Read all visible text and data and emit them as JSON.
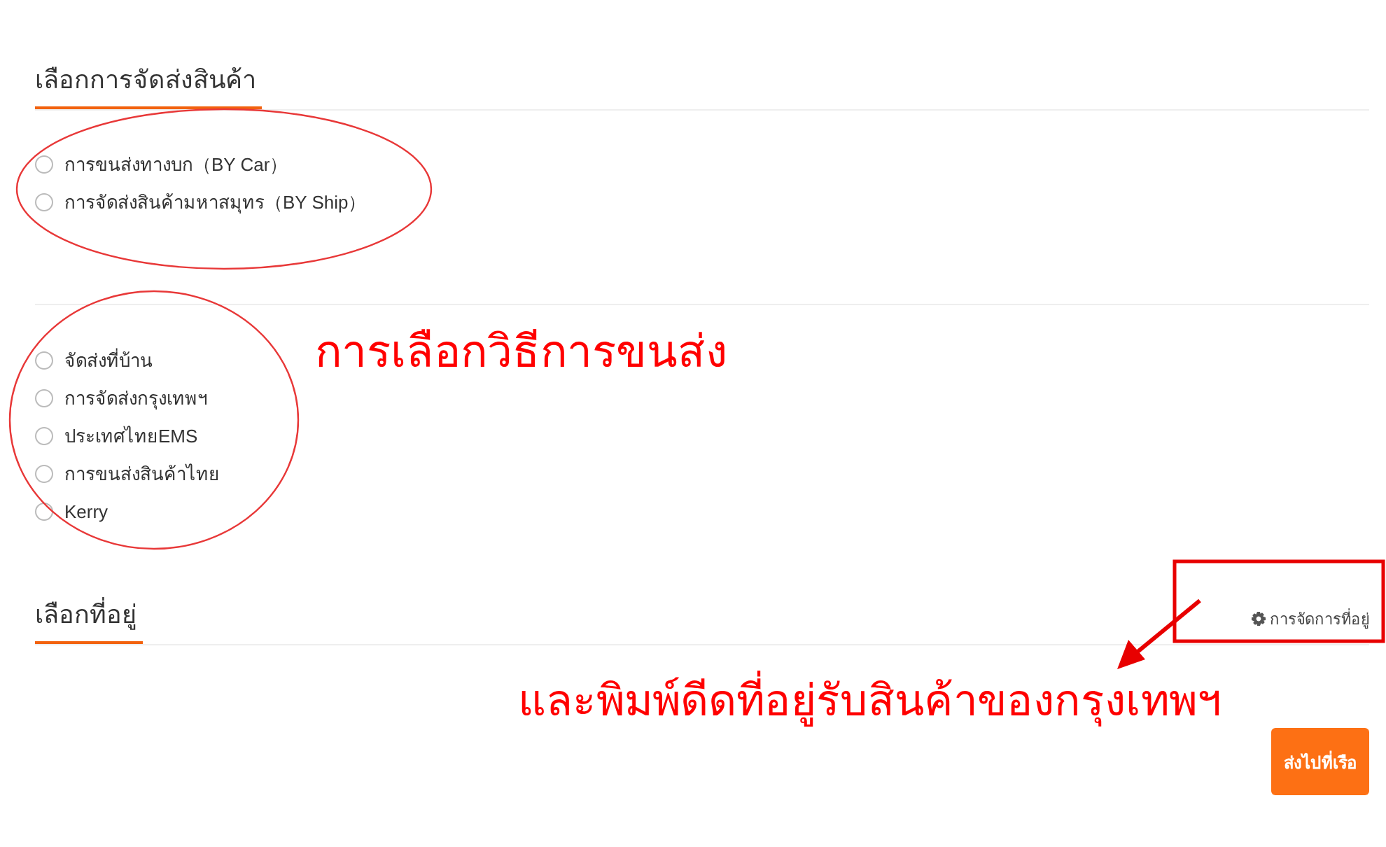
{
  "shipping_section": {
    "title": "เลือกการจัดส่งสินค้า",
    "options": [
      {
        "label": "การขนส่งทางบก（BY Car）",
        "selected": false
      },
      {
        "label": "การจัดส่งสินค้ามหาสมุทร（BY Ship）",
        "selected": false
      }
    ]
  },
  "delivery_options": [
    {
      "label": "จัดส่งที่บ้าน",
      "selected": false
    },
    {
      "label": "การจัดส่งกรุงเทพฯ",
      "selected": false
    },
    {
      "label": "ประเทศไทยEMS",
      "selected": false
    },
    {
      "label": "การขนส่งสินค้าไทย",
      "selected": false
    },
    {
      "label": "Kerry",
      "selected": false
    }
  ],
  "address_section": {
    "title": "เลือกที่อยู่",
    "manage_link": "การจัดการที่อยู่"
  },
  "submit_button": "ส่งไปที่เรือ",
  "annotations": [
    "การเลือกวิธีการขนส่ง",
    "และพิมพ์ดีดที่อยู่รับสินค้าของกรุงเทพฯ"
  ]
}
